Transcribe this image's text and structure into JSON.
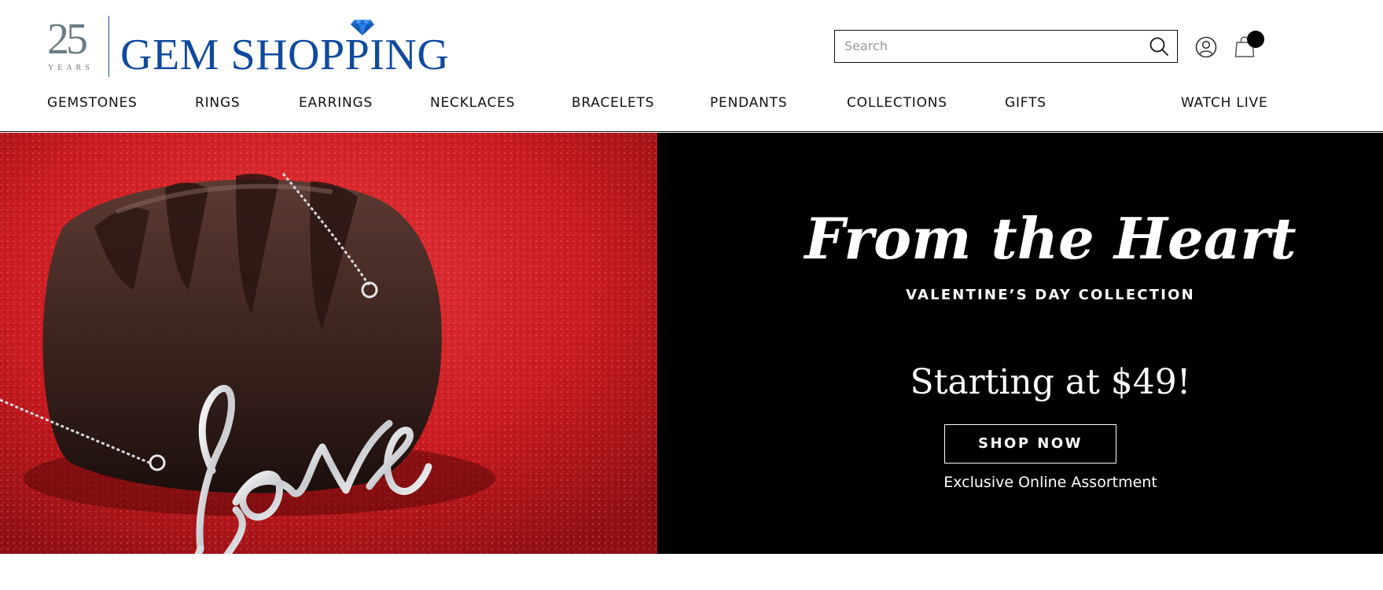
{
  "header": {
    "logo": {
      "years_number": "25",
      "years_label": "YEARS",
      "brand_name": "GEM SHOPPING",
      "brand_color": "#0f4a9e"
    },
    "search": {
      "placeholder": "Search",
      "icon": "search-icon"
    },
    "account_icon": "user-account-icon",
    "cart_icon": "shopping-bag-icon"
  },
  "nav": {
    "items": [
      {
        "label": "GEMSTONES"
      },
      {
        "label": "RINGS"
      },
      {
        "label": "EARRINGS"
      },
      {
        "label": "NECKLACES"
      },
      {
        "label": "BRACELETS"
      },
      {
        "label": "PENDANTS"
      },
      {
        "label": "COLLECTIONS"
      },
      {
        "label": "GIFTS"
      },
      {
        "label": "WATCH LIVE"
      }
    ]
  },
  "hero": {
    "title": "From the Heart",
    "subtitle": "VALENTINE’S DAY COLLECTION",
    "price_text": "Starting at $49!",
    "cta_label": "SHOP NOW",
    "note": "Exclusive Online Assortment",
    "image_word": "Love",
    "panel_color": "#000000",
    "image_background_color": "#c8171c"
  }
}
